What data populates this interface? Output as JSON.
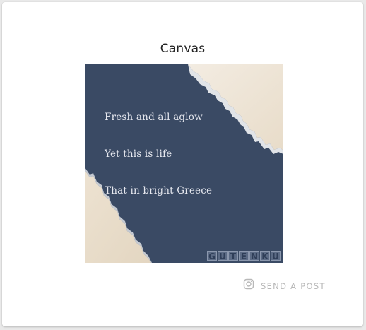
{
  "card": {
    "title": "Canvas"
  },
  "canvas": {
    "poem": [
      "Fresh and all aglow",
      "Yet this is life",
      "That in bright Greece"
    ],
    "watermark_letters": [
      "G",
      "U",
      "T",
      "E",
      "N",
      "K",
      "U"
    ]
  },
  "actions": {
    "send_post_label": "SEND A POST",
    "send_post_icon": "instagram-icon"
  },
  "colors": {
    "canvas_background": "#3a4a64",
    "paper": "#efe6d8",
    "action_text": "#b8b8b8"
  }
}
